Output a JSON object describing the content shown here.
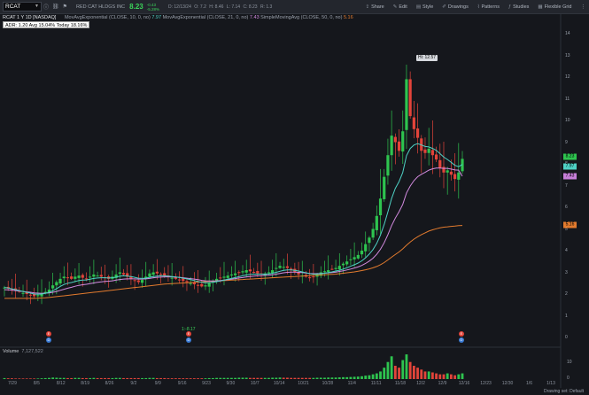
{
  "toolbar": {
    "symbol": "RCAT",
    "company": "RED CAT HLDGS INC",
    "last": "8.23",
    "change1": "-0.43",
    "change2": "-5.28%",
    "stats": [
      "D: 12/13/24",
      "O: 7.2",
      "H: 8.46",
      "L: 7.14",
      "C: 8.23",
      "R: 1.3"
    ],
    "buttons": [
      "Share",
      "Edit",
      "Style",
      "Drawings",
      "Patterns",
      "Studies",
      "Flexible Grid"
    ]
  },
  "legend": {
    "title": "RCAT 1 Y 1D [NASDAQ]",
    "studies": [
      {
        "name": "MovAvgExponential",
        "params": "(CLOSE, 10, 0, no)",
        "value": "7.97"
      },
      {
        "name": "MovAvgExponential",
        "params": "(CLOSE, 21, 0, no)",
        "value": "7.43"
      },
      {
        "name": "SimpleMovingAvg",
        "params": "(CLOSE, 50, 0, no)",
        "value": "5.16"
      }
    ]
  },
  "adr": {
    "text": "ADR: 1.20  Avg 15.04%  Today 18.16%"
  },
  "high_label": "Hi: 12.57",
  "split_label": "1:-8.17",
  "price_tags": [
    {
      "value": "8.23",
      "color": "#2ec44f"
    },
    {
      "value": "7.97",
      "color": "#4fd1c5"
    },
    {
      "value": "7.43",
      "color": "#c77fd9"
    },
    {
      "value": "5.16",
      "color": "#e37b2e"
    }
  ],
  "y_axis": [
    "14",
    "13",
    "12",
    "11",
    "10",
    "9",
    "8",
    "7",
    "6",
    "5",
    "4",
    "3",
    "2",
    "1",
    "0"
  ],
  "x_axis": [
    "7/29",
    "8/5",
    "8/12",
    "8/19",
    "8/26",
    "9/2",
    "9/9",
    "9/16",
    "9/23",
    "9/30",
    "10/7",
    "10/14",
    "10/21",
    "10/28",
    "11/4",
    "11/11",
    "11/18",
    "12/2",
    "12/9",
    "12/16",
    "12/23",
    "12/30",
    "1/6",
    "1/13"
  ],
  "volume": {
    "label": "Volume",
    "value": "7,127,522",
    "axis": [
      "10",
      "0"
    ]
  },
  "footer": "Drawing set: Default",
  "colors": {
    "up": "#2ec44f",
    "down": "#e2443a",
    "ema10": "#4fd1c5",
    "ema21": "#d38be0",
    "sma50": "#e37b2e"
  },
  "chart_data": {
    "type": "candlestick",
    "ylim": [
      0,
      14
    ],
    "y_ticks": [
      0,
      1,
      2,
      3,
      4,
      5,
      6,
      7,
      8,
      9,
      10,
      11,
      12,
      13,
      14
    ],
    "closes": [
      2.3,
      2.25,
      2.2,
      2.15,
      2.1,
      2.05,
      2.0,
      1.95,
      1.9,
      1.95,
      2.0,
      2.1,
      2.2,
      2.4,
      2.55,
      2.7,
      2.8,
      2.75,
      2.7,
      2.8,
      2.85,
      2.75,
      2.7,
      2.8,
      2.9,
      2.85,
      2.8,
      2.75,
      2.7,
      2.8,
      2.9,
      3.0,
      2.9,
      2.8,
      2.7,
      2.6,
      2.55,
      2.65,
      2.8,
      2.95,
      3.0,
      2.95,
      2.9,
      2.85,
      2.8,
      2.75,
      2.7,
      2.65,
      2.6,
      2.55,
      2.5,
      2.45,
      2.4,
      2.35,
      2.4,
      2.5,
      2.6,
      2.7,
      2.75,
      2.8,
      2.85,
      2.9,
      2.95,
      3.0,
      3.05,
      3.1,
      3.05,
      3.0,
      2.95,
      2.9,
      2.95,
      3.0,
      3.1,
      3.2,
      3.3,
      3.25,
      3.2,
      3.1,
      3.0,
      2.9,
      2.85,
      2.8,
      2.75,
      2.8,
      2.9,
      3.0,
      3.05,
      3.1,
      3.15,
      3.2,
      3.3,
      3.4,
      3.5,
      3.6,
      3.7,
      3.8,
      4.0,
      4.3,
      4.6,
      5.0,
      5.6,
      6.4,
      7.4,
      8.4,
      9.3,
      9.0,
      8.6,
      9.5,
      11.9,
      10.2,
      9.6,
      9.2,
      8.6,
      8.5,
      8.7,
      8.4,
      8.2,
      7.8,
      7.6,
      7.7,
      7.5,
      7.3,
      7.6,
      8.23
    ],
    "volume": [
      0.5,
      0.4,
      0.4,
      0.3,
      0.3,
      0.3,
      0.3,
      0.3,
      0.3,
      0.3,
      0.4,
      0.5,
      0.6,
      0.8,
      0.7,
      0.6,
      0.6,
      0.5,
      0.5,
      0.6,
      0.6,
      0.5,
      0.5,
      0.5,
      0.6,
      0.5,
      0.5,
      0.5,
      0.5,
      0.5,
      0.6,
      0.6,
      0.5,
      0.5,
      0.5,
      0.5,
      0.5,
      0.5,
      0.5,
      0.6,
      0.6,
      0.5,
      0.5,
      0.5,
      0.4,
      0.4,
      0.4,
      0.4,
      0.4,
      0.4,
      0.4,
      0.4,
      0.4,
      0.4,
      0.4,
      0.5,
      0.5,
      0.6,
      0.6,
      0.6,
      0.6,
      0.6,
      0.6,
      0.7,
      0.7,
      0.7,
      0.6,
      0.6,
      0.6,
      0.6,
      0.6,
      0.6,
      0.7,
      0.7,
      0.8,
      0.7,
      0.7,
      0.6,
      0.6,
      0.6,
      0.6,
      0.6,
      0.6,
      0.6,
      0.7,
      0.7,
      0.7,
      0.8,
      0.8,
      0.8,
      0.9,
      1.0,
      1.0,
      1.1,
      1.2,
      1.3,
      1.5,
      1.8,
      2.0,
      2.5,
      3.0,
      4.0,
      6.0,
      9.0,
      12.0,
      7.0,
      6.0,
      10.0,
      13.0,
      9.0,
      7.0,
      6.0,
      5.0,
      4.0,
      4.0,
      3.5,
      3.0,
      2.5,
      2.5,
      3.0,
      2.5,
      2.0,
      2.5,
      3.0
    ],
    "ema10": [
      2.3,
      2.28,
      2.24,
      2.2,
      2.16,
      2.12,
      2.08,
      2.04,
      2.0,
      1.99,
      2.0,
      2.03,
      2.08,
      2.15,
      2.25,
      2.35,
      2.44,
      2.5,
      2.53,
      2.58,
      2.62,
      2.64,
      2.65,
      2.68,
      2.72,
      2.74,
      2.75,
      2.75,
      2.74,
      2.75,
      2.78,
      2.82,
      2.84,
      2.83,
      2.81,
      2.77,
      2.73,
      2.72,
      2.73,
      2.77,
      2.81,
      2.83,
      2.84,
      2.84,
      2.83,
      2.81,
      2.79,
      2.76,
      2.73,
      2.7,
      2.66,
      2.62,
      2.58,
      2.54,
      2.52,
      2.52,
      2.54,
      2.57,
      2.6,
      2.64,
      2.68,
      2.72,
      2.76,
      2.8,
      2.84,
      2.88,
      2.9,
      2.92,
      2.92,
      2.92,
      2.92,
      2.93,
      2.96,
      3.0,
      3.05,
      3.09,
      3.11,
      3.11,
      3.09,
      3.06,
      3.02,
      2.98,
      2.94,
      2.92,
      2.92,
      2.94,
      2.96,
      2.99,
      3.02,
      3.06,
      3.1,
      3.15,
      3.21,
      3.28,
      3.35,
      3.43,
      3.53,
      3.67,
      3.84,
      4.05,
      4.33,
      4.71,
      5.2,
      5.78,
      6.4,
      6.87,
      7.18,
      7.6,
      8.38,
      8.71,
      8.87,
      8.93,
      8.87,
      8.8,
      8.78,
      8.71,
      8.62,
      8.47,
      8.31,
      8.2,
      8.07,
      7.93,
      7.87,
      7.97
    ],
    "ema21": [
      2.2,
      2.19,
      2.18,
      2.16,
      2.14,
      2.12,
      2.1,
      2.08,
      2.05,
      2.04,
      2.03,
      2.04,
      2.05,
      2.08,
      2.12,
      2.17,
      2.22,
      2.27,
      2.31,
      2.36,
      2.4,
      2.43,
      2.45,
      2.48,
      2.51,
      2.54,
      2.56,
      2.58,
      2.59,
      2.61,
      2.64,
      2.67,
      2.69,
      2.7,
      2.7,
      2.7,
      2.69,
      2.69,
      2.7,
      2.72,
      2.75,
      2.77,
      2.78,
      2.79,
      2.79,
      2.79,
      2.78,
      2.77,
      2.75,
      2.73,
      2.71,
      2.69,
      2.66,
      2.63,
      2.61,
      2.6,
      2.6,
      2.61,
      2.62,
      2.64,
      2.66,
      2.68,
      2.71,
      2.74,
      2.76,
      2.79,
      2.81,
      2.83,
      2.84,
      2.85,
      2.86,
      2.87,
      2.89,
      2.92,
      2.95,
      2.98,
      3.0,
      3.01,
      3.01,
      3.0,
      2.99,
      2.97,
      2.95,
      2.94,
      2.94,
      2.95,
      2.96,
      2.98,
      2.99,
      3.01,
      3.04,
      3.07,
      3.11,
      3.15,
      3.2,
      3.25,
      3.32,
      3.41,
      3.52,
      3.65,
      3.83,
      4.06,
      4.36,
      4.73,
      5.15,
      5.5,
      5.79,
      6.13,
      6.66,
      6.98,
      7.23,
      7.41,
      7.52,
      7.61,
      7.71,
      7.77,
      7.81,
      7.81,
      7.79,
      7.79,
      7.76,
      7.72,
      7.71,
      7.43
    ],
    "sma50": [
      1.8,
      1.8,
      1.8,
      1.8,
      1.8,
      1.8,
      1.8,
      1.8,
      1.8,
      1.81,
      1.82,
      1.83,
      1.84,
      1.86,
      1.88,
      1.9,
      1.92,
      1.94,
      1.96,
      1.98,
      2.0,
      2.02,
      2.04,
      2.06,
      2.08,
      2.1,
      2.12,
      2.14,
      2.16,
      2.18,
      2.2,
      2.22,
      2.24,
      2.26,
      2.28,
      2.3,
      2.32,
      2.34,
      2.36,
      2.38,
      2.4,
      2.42,
      2.44,
      2.46,
      2.47,
      2.48,
      2.49,
      2.5,
      2.51,
      2.52,
      2.53,
      2.54,
      2.55,
      2.56,
      2.57,
      2.58,
      2.59,
      2.6,
      2.61,
      2.62,
      2.63,
      2.64,
      2.65,
      2.66,
      2.67,
      2.68,
      2.69,
      2.7,
      2.71,
      2.72,
      2.73,
      2.74,
      2.75,
      2.76,
      2.77,
      2.78,
      2.79,
      2.8,
      2.81,
      2.82,
      2.83,
      2.84,
      2.85,
      2.86,
      2.87,
      2.88,
      2.89,
      2.9,
      2.91,
      2.92,
      2.94,
      2.96,
      2.98,
      3.0,
      3.02,
      3.05,
      3.08,
      3.12,
      3.16,
      3.21,
      3.27,
      3.35,
      3.45,
      3.57,
      3.7,
      3.82,
      3.94,
      4.08,
      4.25,
      4.4,
      4.53,
      4.64,
      4.74,
      4.82,
      4.9,
      4.96,
      5.01,
      5.05,
      5.08,
      5.1,
      5.12,
      5.13,
      5.15,
      5.16
    ]
  }
}
